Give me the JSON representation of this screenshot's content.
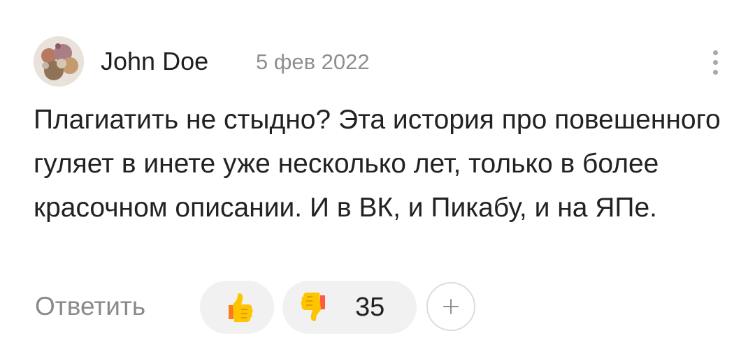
{
  "comment": {
    "author": "John Doe",
    "date": "5 фев 2022",
    "text": "Плагиатить не стыдно? Эта история про повешенного гуляет в инете уже несколько лет, только в более красочном описании. И в ВК, и Пикабу, и на ЯПе."
  },
  "actions": {
    "reply_label": "Ответить",
    "dislike_count": "35"
  },
  "icons": {
    "avatar": "avatar-image",
    "more": "vertical-dots-icon",
    "like": "thumbs-up-icon",
    "dislike": "thumbs-down-icon",
    "add_reaction": "plus-icon"
  },
  "colors": {
    "text": "#222222",
    "muted": "#8a8a8a",
    "pill_bg": "#f1f1f1"
  }
}
